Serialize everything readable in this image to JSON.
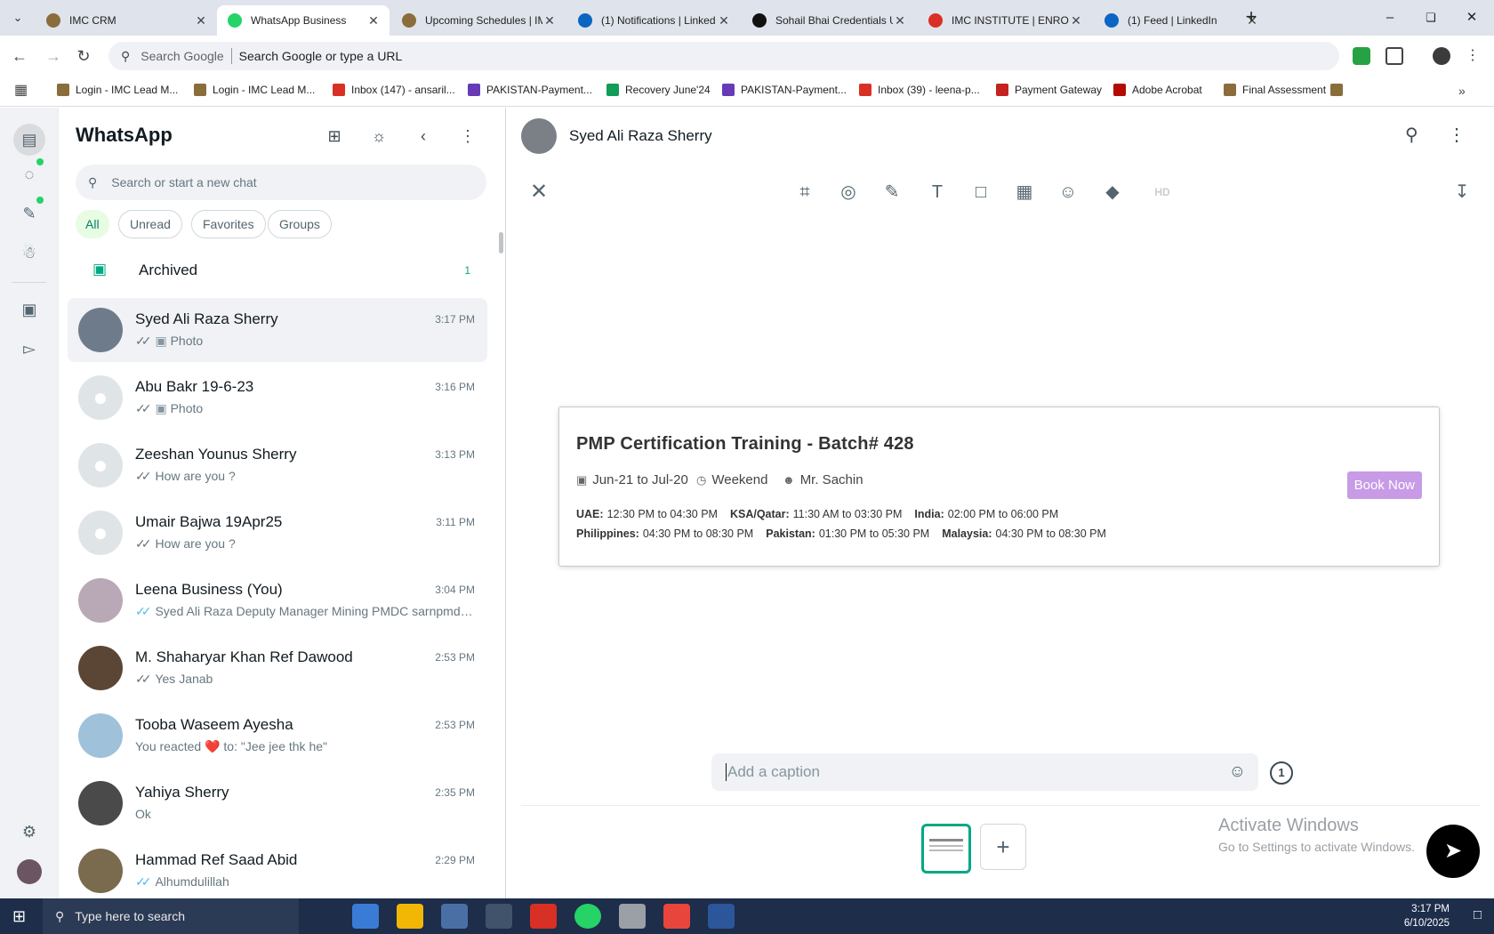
{
  "browser": {
    "tabs": [
      {
        "label": "IMC CRM",
        "favicon": "crm-favicon",
        "active": false
      },
      {
        "label": "WhatsApp Business",
        "favicon": "whatsapp-favicon",
        "active": true
      },
      {
        "label": "Upcoming Schedules | IM",
        "favicon": "imc-favicon",
        "active": false
      },
      {
        "label": "(1) Notifications | Linked",
        "favicon": "linkedin-favicon",
        "active": false
      },
      {
        "label": "Sohail Bhai Credentials U",
        "favicon": "openai-favicon",
        "active": false
      },
      {
        "label": "IMC INSTITUTE | ENROLL",
        "favicon": "gmail-favicon",
        "active": false
      },
      {
        "label": "(1) Feed | LinkedIn",
        "favicon": "linkedin-favicon",
        "active": false
      }
    ],
    "omnibox": {
      "prefix": "Search Google",
      "placeholder": "Search Google or type a URL"
    },
    "bookmarks": [
      {
        "label": "Login - IMC Lead M...",
        "icon": "imc-icon",
        "color": "#8a6d3b"
      },
      {
        "label": "Login - IMC Lead M...",
        "icon": "imc-icon",
        "color": "#8a6d3b"
      },
      {
        "label": "Inbox (147) - ansaril...",
        "icon": "gmail-icon",
        "color": "#d93025"
      },
      {
        "label": "PAKISTAN-Payment...",
        "icon": "forms-icon",
        "color": "#673ab7"
      },
      {
        "label": "Recovery June'24",
        "icon": "sheets-icon",
        "color": "#0f9d58"
      },
      {
        "label": "PAKISTAN-Payment...",
        "icon": "forms-icon",
        "color": "#673ab7"
      },
      {
        "label": "Inbox (39) - leena-p...",
        "icon": "gmail-icon",
        "color": "#d93025"
      },
      {
        "label": "Payment Gateway",
        "icon": "payment-icon",
        "color": "#c5221f"
      },
      {
        "label": "Adobe Acrobat",
        "icon": "acrobat-icon",
        "color": "#b30b00"
      },
      {
        "label": "Final Assessment",
        "icon": "imc-icon",
        "color": "#8a6d3b"
      }
    ]
  },
  "whatsapp": {
    "title": "WhatsApp",
    "search_placeholder": "Search or start a new chat",
    "filters": [
      "All",
      "Unread",
      "Favorites",
      "Groups"
    ],
    "archived": {
      "label": "Archived",
      "count": "1"
    },
    "chats": [
      {
        "name": "Syed Ali Raza Sherry",
        "time": "3:17 PM",
        "preview": "Photo",
        "photo": true,
        "tick": "gray",
        "avatar": "photo",
        "selected": true
      },
      {
        "name": "Abu Bakr 19-6-23",
        "time": "3:16 PM",
        "preview": "Photo",
        "photo": true,
        "tick": "gray",
        "avatar": "default",
        "selected": false
      },
      {
        "name": "Zeeshan Younus Sherry",
        "time": "3:13 PM",
        "preview": "How are you ?",
        "photo": false,
        "tick": "gray",
        "avatar": "default",
        "selected": false
      },
      {
        "name": "Umair Bajwa 19Apr25",
        "time": "3:11 PM",
        "preview": "How are you ?",
        "photo": false,
        "tick": "gray",
        "avatar": "default",
        "selected": false
      },
      {
        "name": "Leena Business (You)",
        "time": "3:04 PM",
        "preview": "Syed Ali Raza Deputy Manager Mining PMDC sarnpmdc...",
        "photo": false,
        "tick": "blue",
        "avatar": "photo",
        "selected": false
      },
      {
        "name": "M. Shaharyar Khan Ref Dawood",
        "time": "2:53 PM",
        "preview": "Yes Janab",
        "photo": false,
        "tick": "gray",
        "avatar": "photo",
        "selected": false
      },
      {
        "name": "Tooba Waseem Ayesha",
        "time": "2:53 PM",
        "preview": "You reacted ❤️ to: \"Jee jee thk he\"",
        "photo": false,
        "tick": "none",
        "avatar": "photo",
        "selected": false
      },
      {
        "name": "Yahiya Sherry",
        "time": "2:35 PM",
        "preview": "Ok",
        "photo": false,
        "tick": "none",
        "avatar": "photo",
        "selected": false
      },
      {
        "name": "Hammad Ref Saad Abid",
        "time": "2:29 PM",
        "preview": "Alhumdulillah",
        "photo": false,
        "tick": "blue",
        "avatar": "photo",
        "selected": false
      }
    ]
  },
  "editor": {
    "contact_name": "Syed Ali Raza Sherry",
    "tools": [
      "crop-icon",
      "filter-icon",
      "pencil-icon",
      "text-icon",
      "rectangle-icon",
      "blur-icon",
      "emoji-icon",
      "sticker-icon",
      "hd-icon"
    ],
    "caption_placeholder": "Add a caption"
  },
  "card": {
    "title": "PMP Certification Training - Batch# 428",
    "dates": "Jun-21 to Jul-20",
    "schedule": "Weekend",
    "instructor": "Mr. Sachin",
    "button": "Book Now",
    "tz_line1": [
      {
        "zone": "UAE:",
        "time": "12:30 PM to 04:30 PM"
      },
      {
        "zone": "KSA/Qatar:",
        "time": "11:30 AM to 03:30 PM"
      },
      {
        "zone": "India:",
        "time": "02:00 PM to 06:00 PM"
      }
    ],
    "tz_line2": [
      {
        "zone": "Philippines:",
        "time": "04:30 PM to 08:30 PM"
      },
      {
        "zone": "Pakistan:",
        "time": "01:30 PM to 05:30 PM"
      },
      {
        "zone": "Malaysia:",
        "time": "04:30 PM to 08:30 PM"
      }
    ],
    "button_color": "#c89be6"
  },
  "watermark": {
    "line1": "Activate Windows",
    "line2": "Go to Settings to activate Windows."
  },
  "taskbar": {
    "search_placeholder": "Type here to search",
    "time": "3:17 PM",
    "date": "6/10/2025"
  }
}
